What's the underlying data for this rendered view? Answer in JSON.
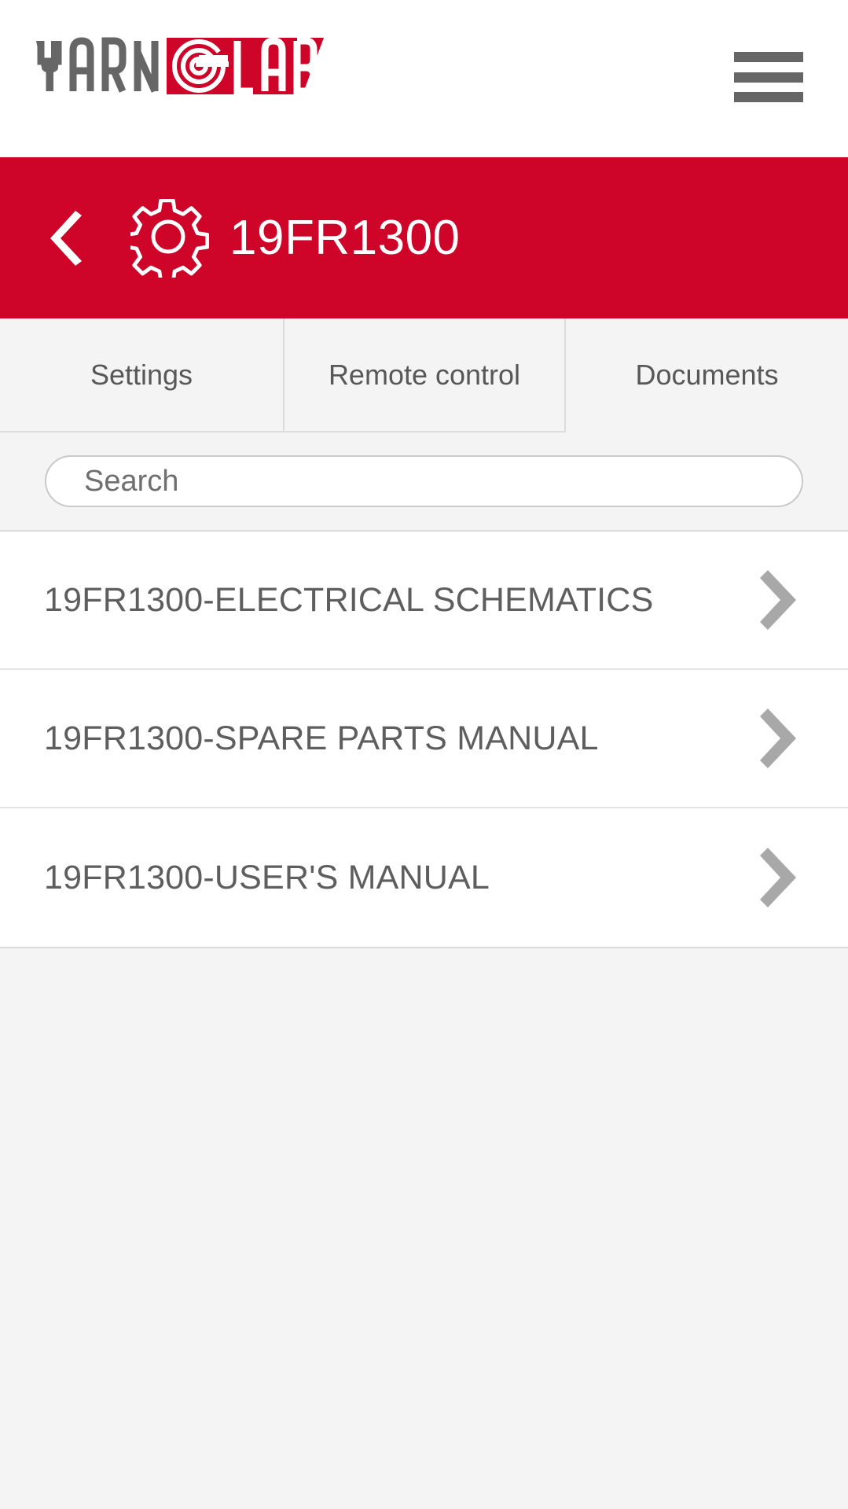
{
  "brand": {
    "logo_text_dark": "YARN",
    "logo_text_light": "LAB",
    "logo_accent_color": "#ce0428",
    "logo_dark_color": "#666666"
  },
  "topbar": {
    "menu_label": "Menu"
  },
  "header": {
    "back_label": "Back",
    "gear_label": "Machine settings",
    "machine_id": "19FR1300",
    "background_color": "#ce0428"
  },
  "tabs": [
    {
      "label": "Settings",
      "active": false
    },
    {
      "label": "Remote control",
      "active": false
    },
    {
      "label": "Documents",
      "active": true
    }
  ],
  "search": {
    "placeholder": "Search",
    "value": ""
  },
  "documents": [
    {
      "title": "19FR1300-ELECTRICAL SCHEMATICS"
    },
    {
      "title": "19FR1300-SPARE PARTS MANUAL"
    },
    {
      "title": "19FR1300-USER'S MANUAL"
    }
  ],
  "colors": {
    "accent": "#ce0428",
    "page_background": "#f4f4f4",
    "row_background": "#ffffff",
    "text_primary": "#5e5e5e",
    "divider": "#dcdcdc",
    "chevron": "#a8a8a8"
  }
}
